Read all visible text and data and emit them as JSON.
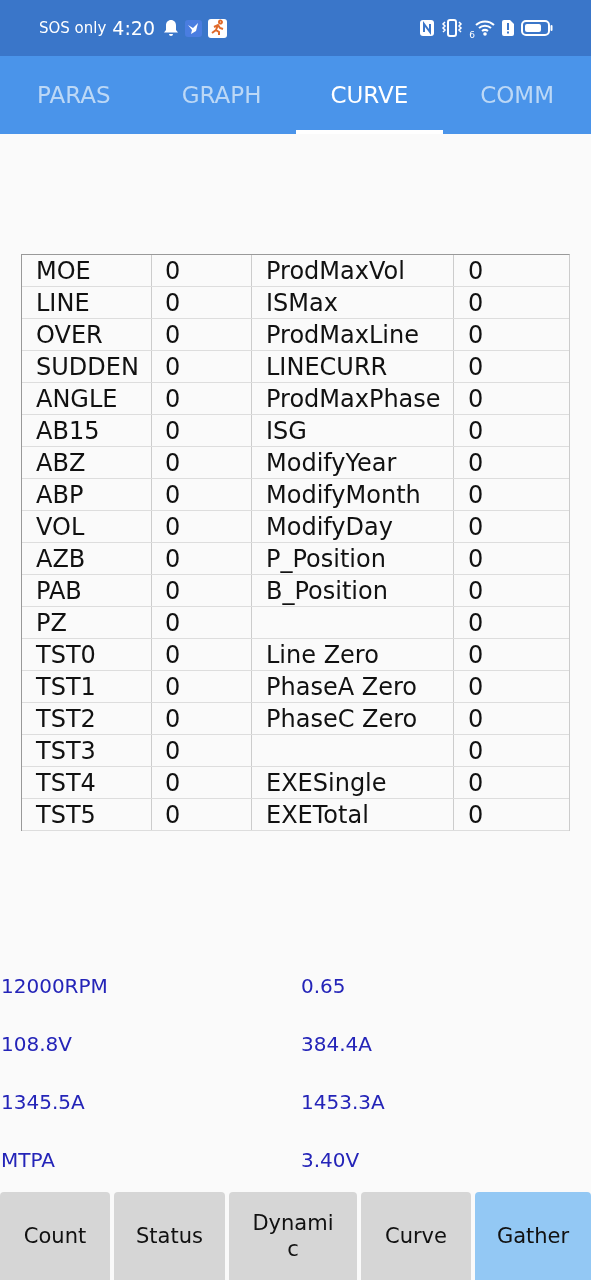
{
  "status_bar": {
    "carrier": "SOS only",
    "time": "4:20",
    "network_label": "6"
  },
  "tabs": [
    {
      "label": "PARAS",
      "selected": false
    },
    {
      "label": "GRAPH",
      "selected": false
    },
    {
      "label": "CURVE",
      "selected": true
    },
    {
      "label": "COMM",
      "selected": false
    }
  ],
  "table": {
    "rows": [
      [
        "MOE",
        "0",
        "ProdMaxVol",
        "0"
      ],
      [
        "LINE",
        "0",
        "ISMax",
        "0"
      ],
      [
        "OVER",
        "0",
        "ProdMaxLine",
        "0"
      ],
      [
        "SUDDEN",
        "0",
        "LINECURR",
        "0"
      ],
      [
        "ANGLE",
        "0",
        "ProdMaxPhase",
        "0"
      ],
      [
        "AB15",
        "0",
        "ISG",
        "0"
      ],
      [
        "ABZ",
        "0",
        "ModifyYear",
        "0"
      ],
      [
        "ABP",
        "0",
        "ModifyMonth",
        "0"
      ],
      [
        "VOL",
        "0",
        "ModifyDay",
        "0"
      ],
      [
        "AZB",
        "0",
        "P_Position",
        "0"
      ],
      [
        "PAB",
        "0",
        "B_Position",
        "0"
      ],
      [
        "PZ",
        "0",
        "",
        "0"
      ],
      [
        "TST0",
        "0",
        "Line Zero",
        "0"
      ],
      [
        "TST1",
        "0",
        "PhaseA Zero",
        "0"
      ],
      [
        "TST2",
        "0",
        "PhaseC Zero",
        "0"
      ],
      [
        "TST3",
        "0",
        "",
        "0"
      ],
      [
        "TST4",
        "0",
        "EXESingle",
        "0"
      ],
      [
        "TST5",
        "0",
        "EXETotal",
        "0"
      ]
    ]
  },
  "readings": [
    [
      "12000RPM",
      "0.65"
    ],
    [
      "108.8V",
      "384.4A"
    ],
    [
      "1345.5A",
      "1453.3A"
    ],
    [
      "MTPA",
      "3.40V"
    ]
  ],
  "buttons": [
    {
      "label": "Count",
      "selected": false
    },
    {
      "label": "Status",
      "selected": false
    },
    {
      "label": "Dynamic",
      "selected": false
    },
    {
      "label": "Curve",
      "selected": false
    },
    {
      "label": "Gather",
      "selected": true
    }
  ]
}
